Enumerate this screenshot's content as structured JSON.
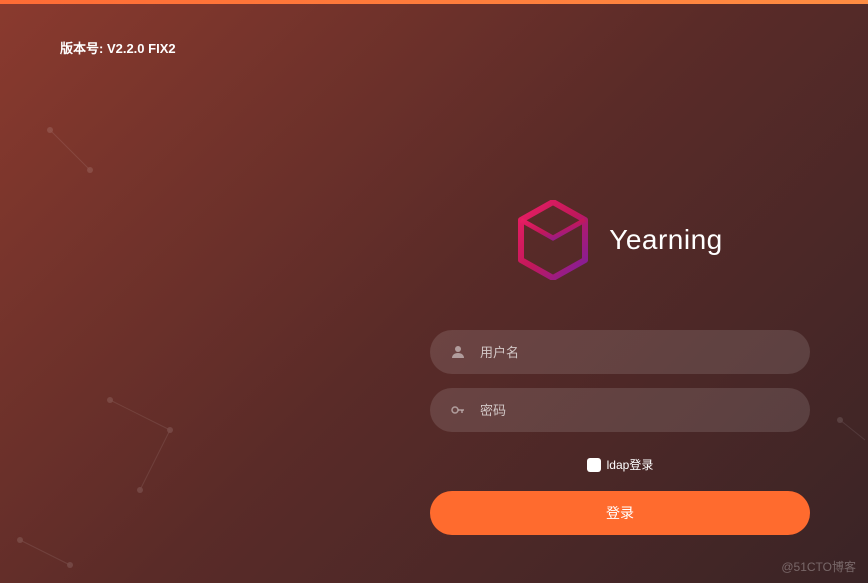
{
  "version": "版本号: V2.2.0 FIX2",
  "app": {
    "title": "Yearning"
  },
  "form": {
    "username_placeholder": "用户名",
    "password_placeholder": "密码",
    "ldap_label": "ldap登录",
    "login_button": "登录"
  },
  "watermark": "@51CTO博客"
}
